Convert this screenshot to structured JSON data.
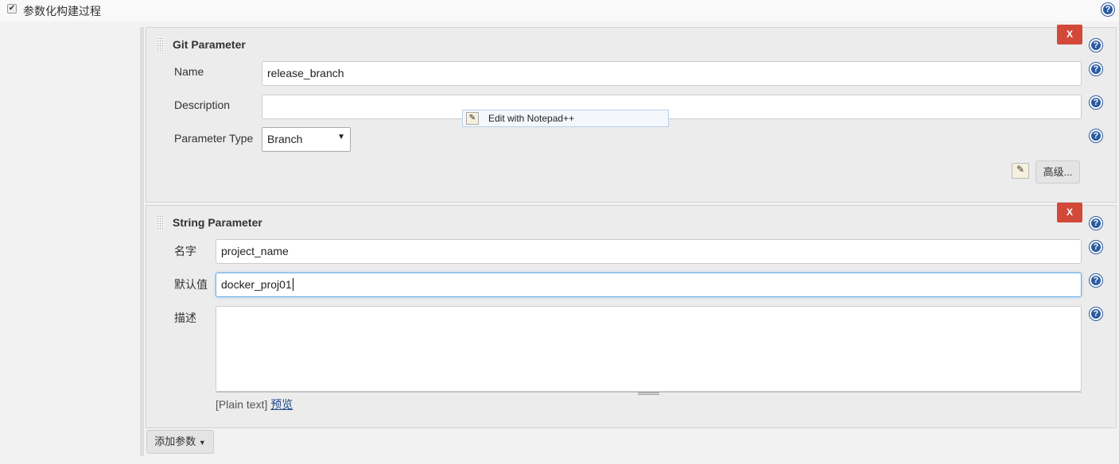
{
  "header": {
    "checkbox_label": "参数化构建过程",
    "checked": true
  },
  "git_parameter": {
    "title": "Git Parameter",
    "delete_label": "X",
    "name_label": "Name",
    "name_value": "release_branch",
    "description_label": "Description",
    "description_value": "",
    "type_label": "Parameter Type",
    "type_value": "Branch",
    "advanced_label": "高级..."
  },
  "tooltip": {
    "label": "Edit with Notepad++"
  },
  "string_parameter": {
    "title": "String Parameter",
    "delete_label": "X",
    "name_label": "名字",
    "name_value": "project_name",
    "default_label": "默认值",
    "default_value": "docker_proj01",
    "description_label": "描述",
    "description_value": "",
    "format_label": "[Plain text]",
    "preview_label": "预览"
  },
  "add_button": {
    "label": "添加参数"
  },
  "colors": {
    "delete": "#d24939",
    "help": "#2a5aa0",
    "panel": "#ececec"
  }
}
